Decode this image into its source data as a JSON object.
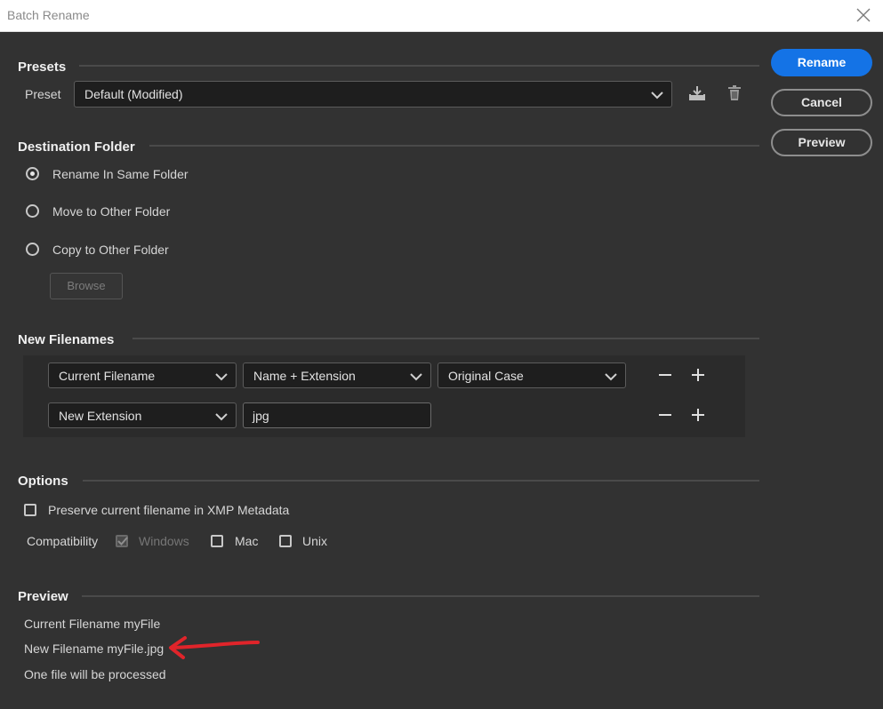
{
  "window": {
    "title": "Batch Rename"
  },
  "actions": {
    "rename": "Rename",
    "cancel": "Cancel",
    "preview": "Preview"
  },
  "presets": {
    "section_title": "Presets",
    "label": "Preset",
    "selected": "Default (Modified)"
  },
  "destination": {
    "section_title": "Destination Folder",
    "options": [
      "Rename In Same Folder",
      "Move to Other Folder",
      "Copy to Other Folder"
    ],
    "selected_index": 0,
    "browse": "Browse"
  },
  "filenames": {
    "section_title": "New Filenames",
    "row1": {
      "type": "Current Filename",
      "format": "Name + Extension",
      "case": "Original Case"
    },
    "row2": {
      "type": "New Extension",
      "value": "jpg"
    }
  },
  "options": {
    "section_title": "Options",
    "preserve": "Preserve current filename in XMP Metadata",
    "compatibility_label": "Compatibility",
    "windows": "Windows",
    "mac": "Mac",
    "unix": "Unix"
  },
  "preview": {
    "section_title": "Preview",
    "current": "Current Filename myFile",
    "new": "New Filename myFile.jpg",
    "count": "One file will be processed"
  },
  "colors": {
    "accent": "#1473e6",
    "annotation": "#e0242a",
    "background": "#323232"
  }
}
